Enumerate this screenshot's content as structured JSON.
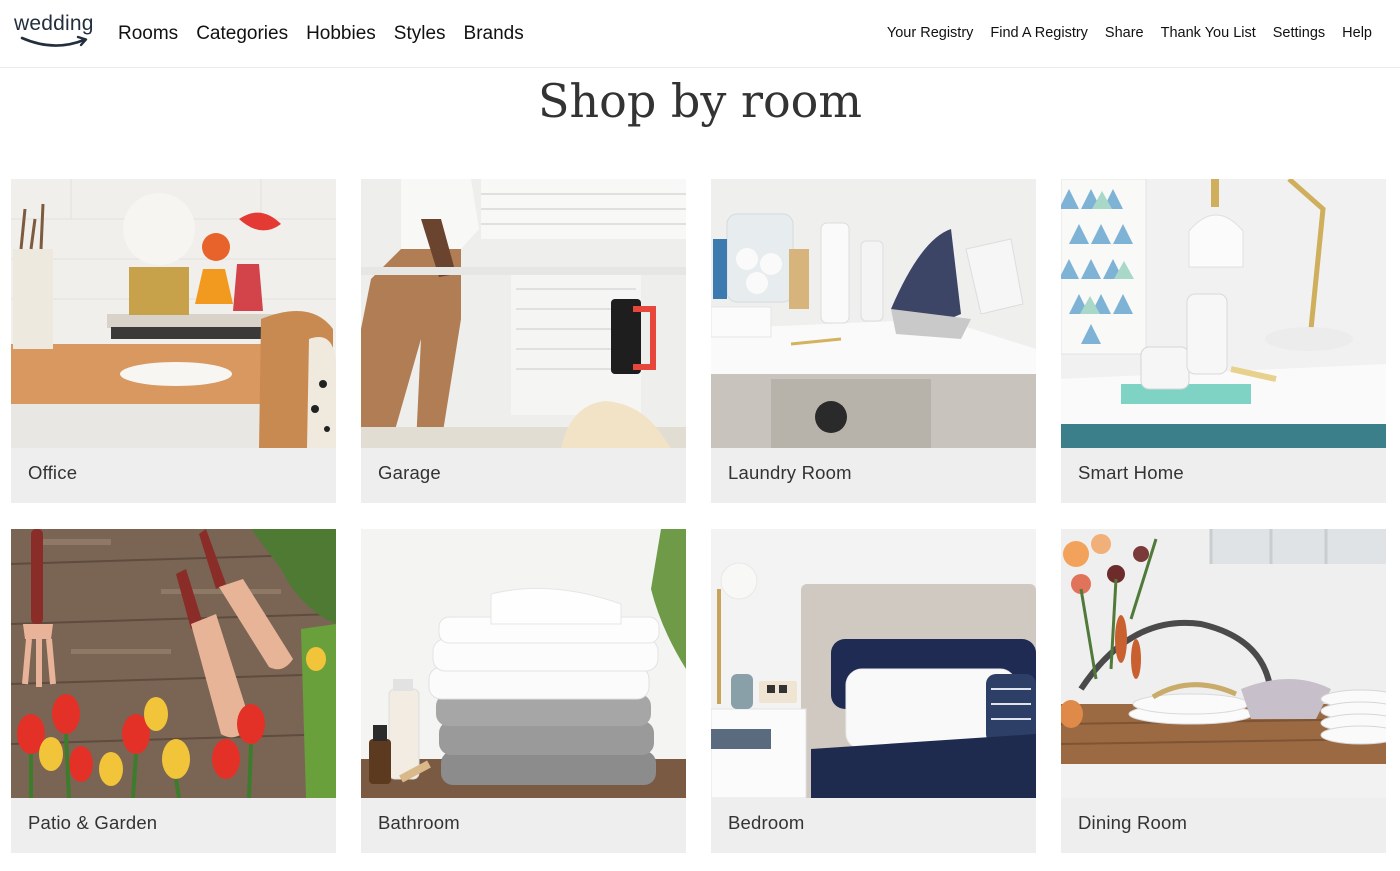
{
  "header": {
    "logo_text": "wedding",
    "nav_left": [
      "Rooms",
      "Categories",
      "Hobbies",
      "Styles",
      "Brands"
    ],
    "nav_right": [
      "Your Registry",
      "Find A Registry",
      "Share",
      "Thank You List",
      "Settings",
      "Help"
    ]
  },
  "page": {
    "title": "Shop by room"
  },
  "rooms": [
    {
      "label": "Office"
    },
    {
      "label": "Garage"
    },
    {
      "label": "Laundry Room"
    },
    {
      "label": "Smart Home"
    },
    {
      "label": "Patio & Garden"
    },
    {
      "label": "Bathroom"
    },
    {
      "label": "Bedroom"
    },
    {
      "label": "Dining Room"
    }
  ],
  "colors": {
    "card_bg": "#eeeeee",
    "title": "#333333",
    "brand_smile": "#232f3e"
  }
}
